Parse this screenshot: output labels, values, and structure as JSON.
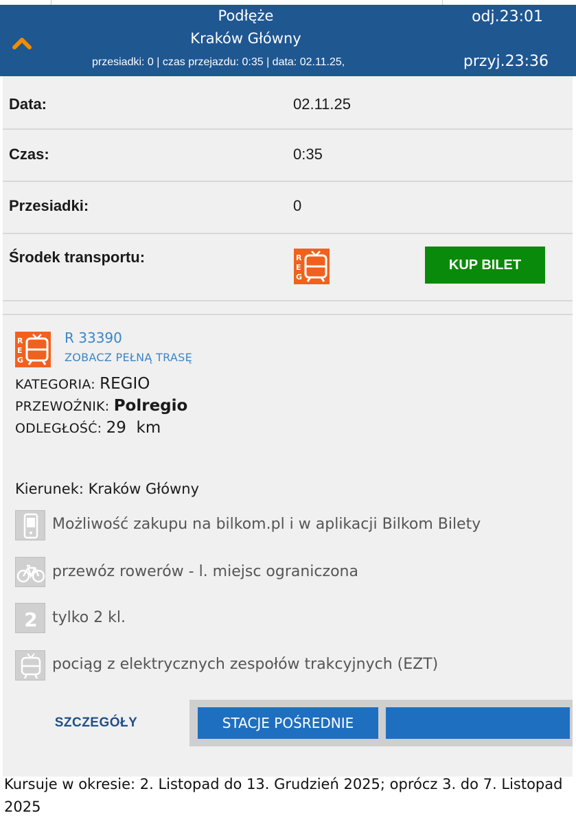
{
  "header": {
    "from_station": "Podłęże",
    "to_station": "Kraków Główny",
    "meta": "przesiadki: 0 | czas przejazdu: 0:35 | data: 02.11.25,",
    "departure": "odj.23:01",
    "arrival": "przyj.23:36"
  },
  "details": {
    "date_label": "Data:",
    "date_value": "02.11.25",
    "time_label": "Czas:",
    "time_value": "0:35",
    "transfers_label": "Przesiadki:",
    "transfers_value": "0",
    "transport_label": "Środek transportu:",
    "buy_label": "KUP BILET"
  },
  "train": {
    "icon_text": "REG",
    "number": "R 33390",
    "route_link": "ZOBACZ PEŁNĄ TRASĘ",
    "category_label": "KATEGORIA:",
    "category_value": "REGIO",
    "carrier_label": "PRZEWOŹNIK:",
    "carrier_value": "Polregio",
    "distance_label": "ODLEGŁOŚĆ:",
    "distance_value": "29  km",
    "direction": "Kierunek: Kraków Główny",
    "features": [
      {
        "icon": "phone-icon",
        "text": "Możliwość zakupu na bilkom.pl i w aplikacji Bilkom Bilety"
      },
      {
        "icon": "bicycle-icon",
        "text": "przewóz rowerów - l. miejsc ograniczona"
      },
      {
        "icon": "class-2-icon",
        "text": "tylko 2 kl."
      },
      {
        "icon": "electric-train-icon",
        "text": "pociąg z elektrycznych zespołów trakcyjnych (EZT)"
      }
    ]
  },
  "tabs": {
    "details": "SZCZEGÓŁY",
    "stations": "STACJE POŚREDNIE",
    "third": ""
  },
  "footer": {
    "schedule": "Kursuje w okresie: 2. Listopad do 13. Grudzień 2025; oprócz 3. do 7. Listopad 2025"
  },
  "colors": {
    "header_bg": "#1f5791",
    "accent_orange": "#f28c00",
    "buy_green": "#0a8a0a",
    "tab_blue": "#1f6fc0",
    "link_blue": "#3a86c8"
  }
}
